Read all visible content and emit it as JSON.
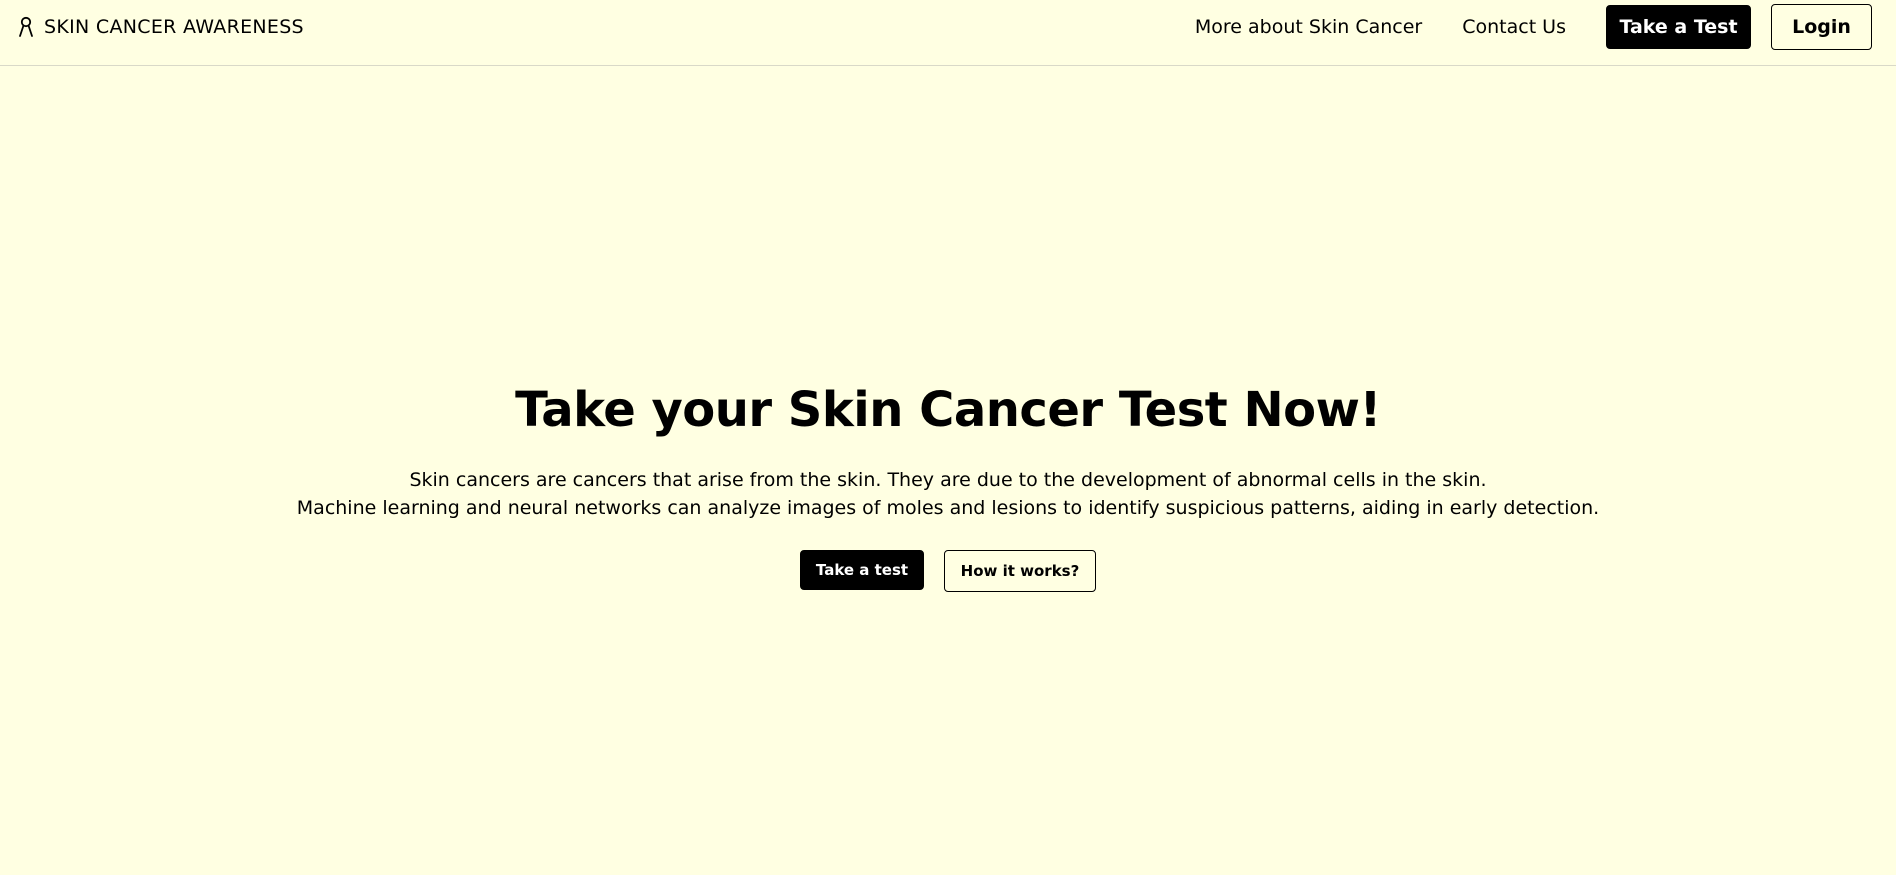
{
  "navbar": {
    "brand_icon": "awareness-ribbon-icon",
    "brand_label": "SKIN CANCER AWARENESS",
    "links": {
      "more": "More about Skin Cancer",
      "contact": "Contact Us"
    },
    "take_test_label": "Take a Test",
    "login_label": "Login"
  },
  "hero": {
    "title": "Take your Skin Cancer Test Now!",
    "description_line1": "Skin cancers are cancers that arise from the skin. They are due to the development of abnormal cells in the skin.",
    "description_line2": "Machine learning and neural networks can analyze images of moles and lesions to identify suspicious patterns, aiding in early detection.",
    "primary_button": "Take a test",
    "secondary_button": "How it works?"
  },
  "colors": {
    "background": "#ffffe2",
    "primary": "#000000",
    "primary_text": "#ffffff"
  }
}
